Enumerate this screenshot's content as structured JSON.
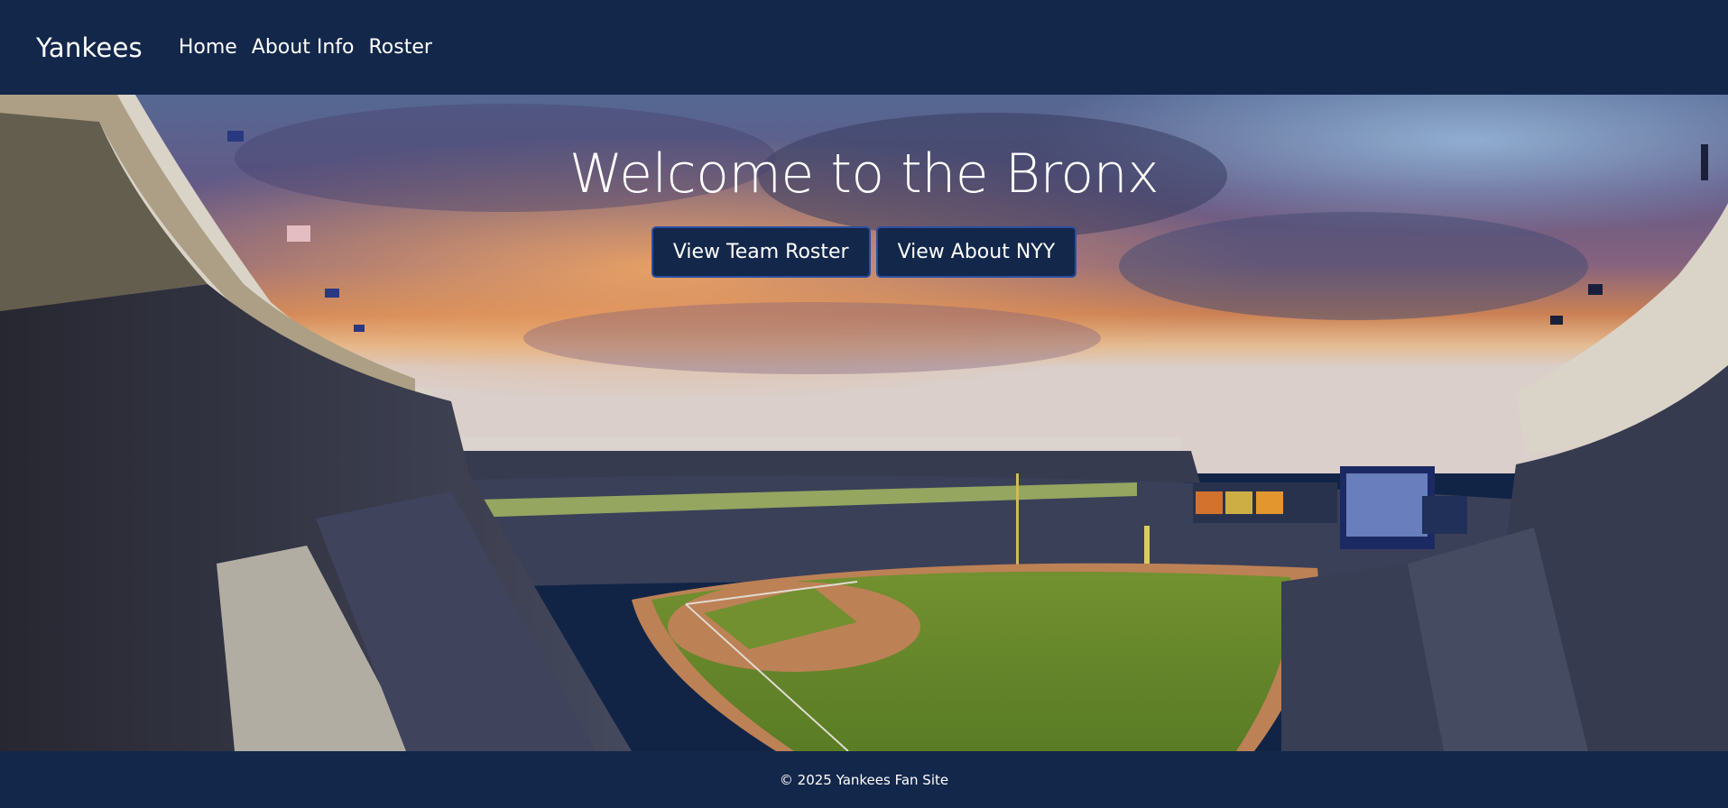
{
  "navbar": {
    "brand": "Yankees",
    "links": [
      {
        "label": "Home"
      },
      {
        "label": "About Info"
      },
      {
        "label": "Roster"
      }
    ]
  },
  "hero": {
    "title": "Welcome to the Bronx",
    "buttons": [
      {
        "label": "View Team Roster"
      },
      {
        "label": "View About NYY"
      }
    ]
  },
  "footer": {
    "text": "© 2025 Yankees Fan Site"
  },
  "colors": {
    "navy": "#13274b",
    "button_border": "#2a4fa0",
    "field_green": "#6f8f2c",
    "infield_dirt": "#c98a5c"
  }
}
